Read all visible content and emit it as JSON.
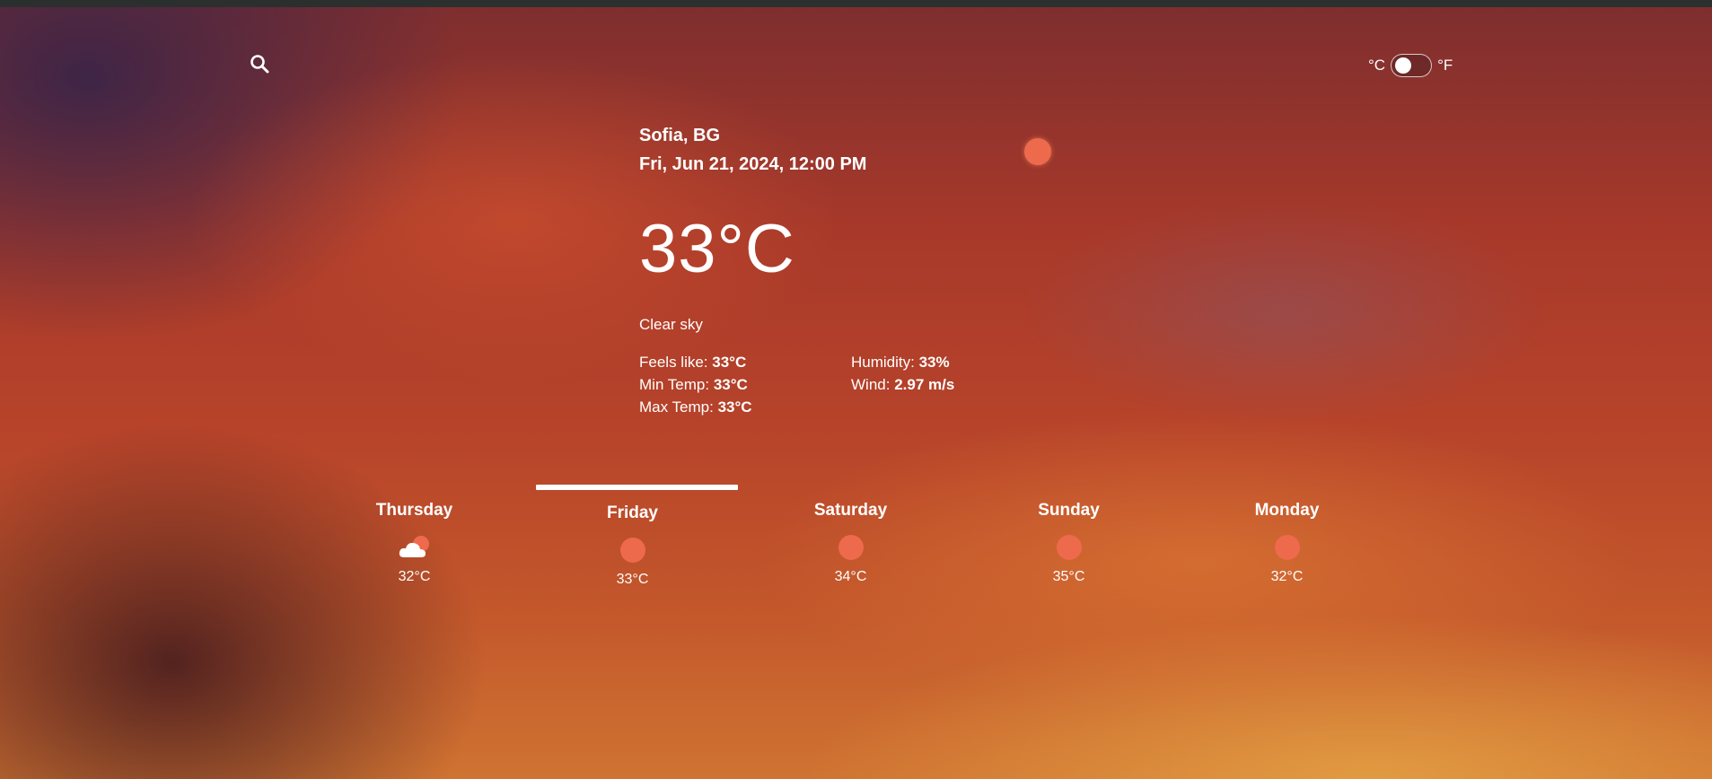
{
  "search": {
    "icon": "search-icon"
  },
  "units": {
    "celsius_label": "°C",
    "fahrenheit_label": "°F",
    "selected": "°C"
  },
  "current": {
    "city": "Sofia, BG",
    "datetime": "Fri, Jun 21, 2024, 12:00 PM",
    "temperature": "33°C",
    "condition": "Clear sky",
    "details": {
      "feels_like": {
        "label": "Feels like: ",
        "value": "33°C"
      },
      "humidity": {
        "label": "Humidity: ",
        "value": "33%"
      },
      "min_temp": {
        "label": "Min Temp: ",
        "value": "33°C"
      },
      "wind": {
        "label": "Wind: ",
        "value": "2.97 m/s"
      },
      "max_temp": {
        "label": "Max Temp: ",
        "value": "33°C"
      }
    },
    "icon": "sun-icon"
  },
  "forecast": [
    {
      "day": "Thursday",
      "temp": "32°C",
      "icon": "partly-cloudy-icon",
      "selected": false
    },
    {
      "day": "Friday",
      "temp": "33°C",
      "icon": "sun-icon",
      "selected": true
    },
    {
      "day": "Saturday",
      "temp": "34°C",
      "icon": "sun-icon",
      "selected": false
    },
    {
      "day": "Sunday",
      "temp": "35°C",
      "icon": "sun-icon",
      "selected": false
    },
    {
      "day": "Monday",
      "temp": "32°C",
      "icon": "sun-icon",
      "selected": false
    }
  ],
  "colors": {
    "sun": "#ee6a4c",
    "text": "#ffffff",
    "topbar": "#2b302f"
  }
}
